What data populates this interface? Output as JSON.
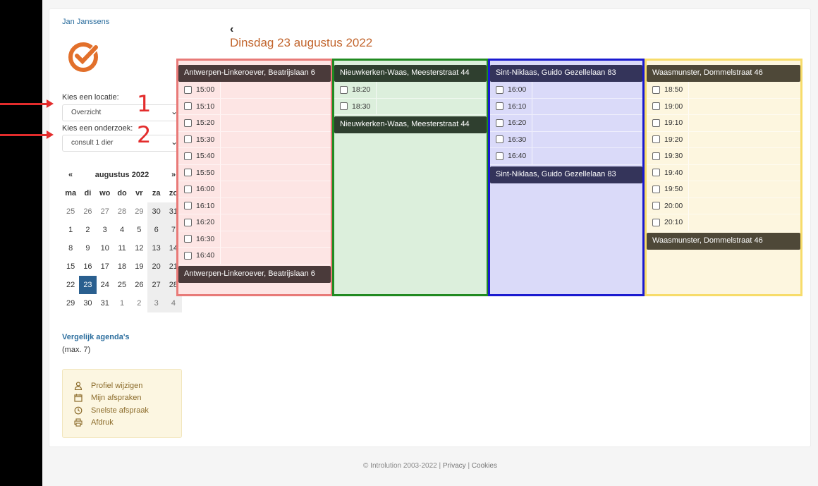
{
  "user": {
    "name": "Jan Janssens"
  },
  "location": {
    "label": "Kies een locatie:",
    "value": "Overzicht"
  },
  "exam": {
    "label": "Kies een onderzoek:",
    "value": "consult 1 dier"
  },
  "annotations": {
    "n1": "1",
    "n2": "2"
  },
  "calendar": {
    "prev": "«",
    "next": "»",
    "month": "augustus 2022",
    "weekdays": [
      "ma",
      "di",
      "wo",
      "do",
      "vr",
      "za",
      "zo"
    ],
    "days": [
      [
        "25",
        "26",
        "27",
        "28",
        "29",
        "30",
        "31"
      ],
      [
        "1",
        "2",
        "3",
        "4",
        "5",
        "6",
        "7"
      ],
      [
        "8",
        "9",
        "10",
        "11",
        "12",
        "13",
        "14"
      ],
      [
        "15",
        "16",
        "17",
        "18",
        "19",
        "20",
        "21"
      ],
      [
        "22",
        "23",
        "24",
        "25",
        "26",
        "27",
        "28"
      ],
      [
        "29",
        "30",
        "31",
        "1",
        "2",
        "3",
        "4"
      ]
    ],
    "selected": "23"
  },
  "compare": {
    "title": "Vergelijk agenda's",
    "max": "(max. 7)"
  },
  "links": [
    {
      "label": "Profiel wijzigen",
      "icon": "user-icon"
    },
    {
      "label": "Mijn afspraken",
      "icon": "calendar-icon"
    },
    {
      "label": "Snelste afspraak",
      "icon": "clock-icon"
    },
    {
      "label": "Afdruk",
      "icon": "print-icon"
    }
  ],
  "header": {
    "back": "‹",
    "title": "Dinsdag 23 augustus 2022"
  },
  "columns": [
    {
      "name": "Antwerpen-Linkeroever, Beatrijslaan 6",
      "border": "#e87a78",
      "bg": "#fde5e4",
      "hdr": "#4a3a3a",
      "slots": [
        "15:00",
        "15:10",
        "15:20",
        "15:30",
        "15:40",
        "15:50",
        "16:00",
        "16:10",
        "16:20",
        "16:30",
        "16:40"
      ]
    },
    {
      "name": "Nieuwkerken-Waas, Meesterstraat 44",
      "border": "#218a21",
      "bg": "#dcefdc",
      "hdr": "#2f3f2f",
      "slots": [
        "18:20",
        "18:30"
      ]
    },
    {
      "name": "Sint-Niklaas, Guido Gezellelaan 83",
      "border": "#1a1ad0",
      "bg": "#dadaf9",
      "hdr": "#34345a",
      "slots": [
        "16:00",
        "16:10",
        "16:20",
        "16:30",
        "16:40"
      ]
    },
    {
      "name": "Waasmunster, Dommelstraat 46",
      "border": "#f7dc6a",
      "bg": "#fdf6df",
      "hdr": "#4e4838",
      "slots": [
        "18:50",
        "19:00",
        "19:10",
        "19:20",
        "19:30",
        "19:40",
        "19:50",
        "20:00",
        "20:10"
      ]
    }
  ],
  "footer": {
    "copy": "© Introlution 2003-2022 |",
    "privacy": "Privacy",
    "sep": "|",
    "cookies": "Cookies"
  }
}
